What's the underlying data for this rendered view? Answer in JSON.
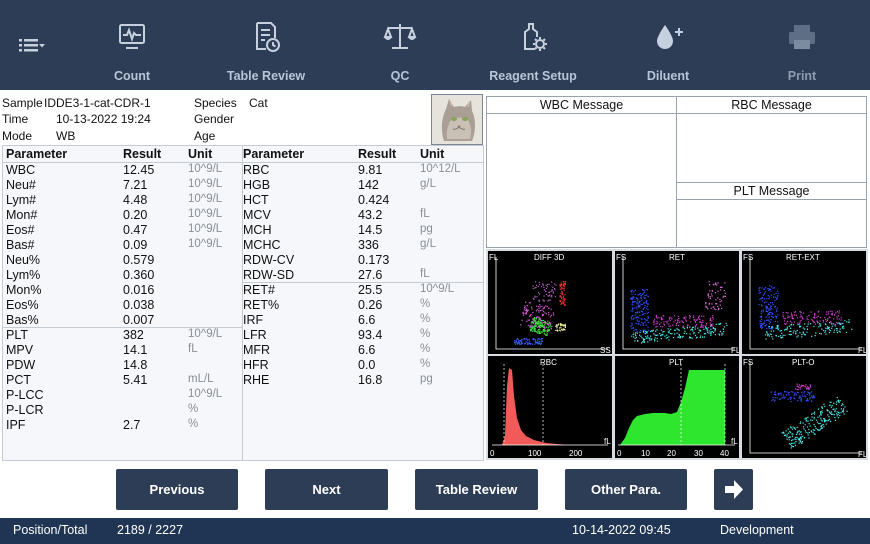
{
  "toolbar": {
    "items": [
      {
        "label": "Count",
        "icon": "monitor-wave-icon"
      },
      {
        "label": "Table Review",
        "icon": "report-clock-icon"
      },
      {
        "label": "QC",
        "icon": "balance-scale-icon"
      },
      {
        "label": "Reagent Setup",
        "icon": "reagent-gear-icon"
      },
      {
        "label": "Diluent",
        "icon": "drop-plus-icon"
      },
      {
        "label": "Print",
        "icon": "printer-icon"
      }
    ],
    "colors": {
      "bar": "#2d3d55",
      "icon": "#c6d0de"
    }
  },
  "sample": {
    "sample_label": "Sample",
    "sample_value": "IDDE3-1-cat-CDR-1",
    "time_label": "Time",
    "time_value": "10-13-2022 19:24",
    "mode_label": "Mode",
    "mode_value": "WB",
    "species_label": "Species",
    "species_value": "Cat",
    "gender_label": "Gender",
    "gender_value": "",
    "age_label": "Age",
    "age_value": ""
  },
  "table": {
    "headers": {
      "parameter": "Parameter",
      "result": "Result",
      "unit": "Unit"
    },
    "left": [
      {
        "p": "WBC",
        "r": "12.45",
        "u": "10^9/L"
      },
      {
        "p": "Neu#",
        "r": "7.21",
        "u": "10^9/L"
      },
      {
        "p": "Lym#",
        "r": "4.48",
        "u": "10^9/L"
      },
      {
        "p": "Mon#",
        "r": "0.20",
        "u": "10^9/L"
      },
      {
        "p": "Eos#",
        "r": "0.47",
        "u": "10^9/L"
      },
      {
        "p": "Bas#",
        "r": "0.09",
        "u": "10^9/L"
      },
      {
        "p": "Neu%",
        "r": "0.579",
        "u": ""
      },
      {
        "p": "Lym%",
        "r": "0.360",
        "u": ""
      },
      {
        "p": "Mon%",
        "r": "0.016",
        "u": ""
      },
      {
        "p": "Eos%",
        "r": "0.038",
        "u": ""
      },
      {
        "p": "Bas%",
        "r": "0.007",
        "u": ""
      },
      {
        "p": "PLT",
        "r": "382",
        "u": "10^9/L"
      },
      {
        "p": "MPV",
        "r": "14.1",
        "u": "fL"
      },
      {
        "p": "PDW",
        "r": "14.8",
        "u": ""
      },
      {
        "p": "PCT",
        "r": "5.41",
        "u": "mL/L"
      },
      {
        "p": "P-LCC",
        "r": "",
        "u": "10^9/L"
      },
      {
        "p": "P-LCR",
        "r": "",
        "u": "%"
      },
      {
        "p": "IPF",
        "r": "2.7",
        "u": "%"
      }
    ],
    "right": [
      {
        "p": "RBC",
        "r": "9.81",
        "u": "10^12/L"
      },
      {
        "p": "HGB",
        "r": "142",
        "u": "g/L"
      },
      {
        "p": "HCT",
        "r": "0.424",
        "u": ""
      },
      {
        "p": "MCV",
        "r": "43.2",
        "u": "fL"
      },
      {
        "p": "MCH",
        "r": "14.5",
        "u": "pg"
      },
      {
        "p": "MCHC",
        "r": "336",
        "u": "g/L"
      },
      {
        "p": "RDW-CV",
        "r": "0.173",
        "u": ""
      },
      {
        "p": "RDW-SD",
        "r": "27.6",
        "u": "fL"
      },
      {
        "p": "RET#",
        "r": "25.5",
        "u": "10^9/L"
      },
      {
        "p": "RET%",
        "r": "0.26",
        "u": "%"
      },
      {
        "p": "IRF",
        "r": "6.6",
        "u": "%"
      },
      {
        "p": "LFR",
        "r": "93.4",
        "u": "%"
      },
      {
        "p": "MFR",
        "r": "6.6",
        "u": "%"
      },
      {
        "p": "HFR",
        "r": "0.0",
        "u": "%"
      },
      {
        "p": "RHE",
        "r": "16.8",
        "u": "pg"
      }
    ]
  },
  "messages": {
    "wbc": "WBC Message",
    "rbc": "RBC Message",
    "plt": "PLT Message"
  },
  "plots": {
    "diff3d": {
      "title": "DIFF 3D",
      "y": "FL",
      "x": "SS"
    },
    "ret": {
      "title": "RET",
      "y": "FS",
      "x": "FL"
    },
    "retext": {
      "title": "RET-EXT",
      "y": "FS",
      "x": "FL"
    },
    "rbc": {
      "title": "RBC",
      "x": "fL",
      "ticks": [
        "0",
        "100",
        "200"
      ]
    },
    "plt": {
      "title": "PLT",
      "x": "fL",
      "ticks": [
        "0",
        "10",
        "20",
        "30",
        "40"
      ]
    },
    "plto": {
      "title": "PLT-O",
      "y": "FS",
      "x": "FL"
    }
  },
  "buttons": {
    "previous": "Previous",
    "next": "Next",
    "table_review": "Table Review",
    "other_para": "Other Para.",
    "arrow_icon": "arrow-right-icon"
  },
  "status": {
    "position_label": "Position/Total",
    "position_value": "2189 / 2227",
    "datetime": "10-14-2022 09:45",
    "mode": "Development"
  }
}
